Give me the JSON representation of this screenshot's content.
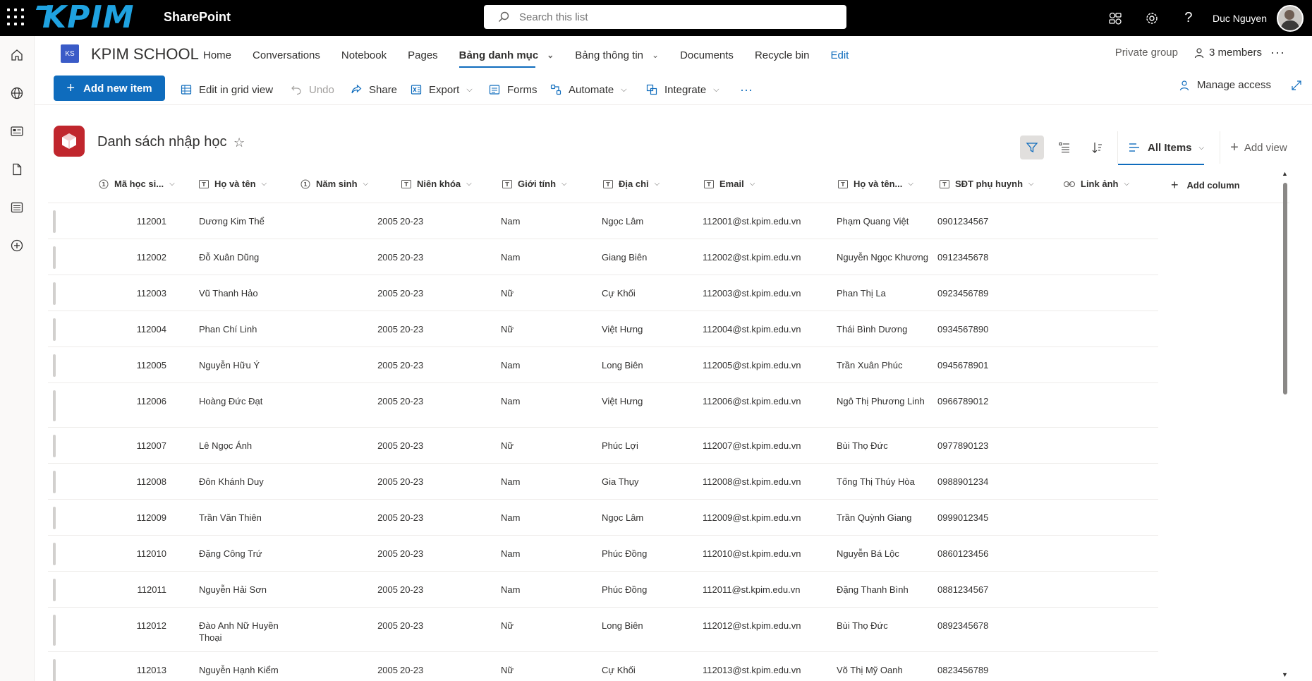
{
  "suite": {
    "logo": "KPIM",
    "app_name": "SharePoint",
    "search_placeholder": "Search this list",
    "user_name": "Duc Nguyen"
  },
  "site": {
    "icon_initials": "KS",
    "name": "KPIM SCHOOL",
    "nav": [
      {
        "label": "Home"
      },
      {
        "label": "Conversations"
      },
      {
        "label": "Notebook"
      },
      {
        "label": "Pages"
      },
      {
        "label": "Bảng danh mục"
      },
      {
        "label": "Bảng thông tin"
      },
      {
        "label": "Documents"
      },
      {
        "label": "Recycle bin"
      },
      {
        "label": "Edit"
      }
    ],
    "privacy": "Private group",
    "members": "3 members"
  },
  "commands": {
    "add_new_item": "Add new item",
    "edit_grid": "Edit in grid view",
    "undo": "Undo",
    "share": "Share",
    "export": "Export",
    "forms": "Forms",
    "automate": "Automate",
    "integrate": "Integrate",
    "manage_access": "Manage access"
  },
  "list": {
    "title": "Danh sách nhập học",
    "view_name": "All Items",
    "add_view": "Add view",
    "columns": [
      {
        "label": "Mã học si..."
      },
      {
        "label": "Họ và tên"
      },
      {
        "label": "Năm sinh"
      },
      {
        "label": "Niên khóa"
      },
      {
        "label": "Giới tính"
      },
      {
        "label": "Địa chỉ"
      },
      {
        "label": "Email"
      },
      {
        "label": "Họ và tên..."
      },
      {
        "label": "SĐT phụ huynh"
      },
      {
        "label": "Link ảnh"
      },
      {
        "label": "Add column"
      }
    ],
    "rows": [
      {
        "id": "112001",
        "name": "Dương Kim Thể",
        "year": "2005",
        "term": "20-23",
        "gender": "Nam",
        "address": "Ngọc Lâm",
        "email": "112001@st.kpim.edu.vn",
        "parent": "Phạm Quang Việt",
        "phone": "0901234567"
      },
      {
        "id": "112002",
        "name": "Đỗ Xuân Dũng",
        "year": "2005",
        "term": "20-23",
        "gender": "Nam",
        "address": "Giang Biên",
        "email": "112002@st.kpim.edu.vn",
        "parent": "Nguyễn Ngọc Khương",
        "phone": "0912345678"
      },
      {
        "id": "112003",
        "name": "Vũ Thanh Hảo",
        "year": "2005",
        "term": "20-23",
        "gender": "Nữ",
        "address": "Cự Khối",
        "email": "112003@st.kpim.edu.vn",
        "parent": "Phan Thị La",
        "phone": "0923456789"
      },
      {
        "id": "112004",
        "name": "Phan Chí Linh",
        "year": "2005",
        "term": "20-23",
        "gender": "Nữ",
        "address": "Việt Hưng",
        "email": "112004@st.kpim.edu.vn",
        "parent": "Thái Bình Dương",
        "phone": "0934567890"
      },
      {
        "id": "112005",
        "name": "Nguyễn Hữu Ý",
        "year": "2005",
        "term": "20-23",
        "gender": "Nam",
        "address": "Long Biên",
        "email": "112005@st.kpim.edu.vn",
        "parent": "Trần Xuân Phúc",
        "phone": "0945678901"
      },
      {
        "id": "112006",
        "name": "Hoàng Đức Đạt",
        "year": "2005",
        "term": "20-23",
        "gender": "Nam",
        "address": "Việt Hưng",
        "email": "112006@st.kpim.edu.vn",
        "parent": "Ngô Thị Phương Linh",
        "phone": "0966789012"
      },
      {
        "id": "112007",
        "name": "Lê Ngọc Ánh",
        "year": "2005",
        "term": "20-23",
        "gender": "Nữ",
        "address": "Phúc Lợi",
        "email": "112007@st.kpim.edu.vn",
        "parent": "Bùi Thọ Đức",
        "phone": "0977890123"
      },
      {
        "id": "112008",
        "name": "Đôn Khánh Duy",
        "year": "2005",
        "term": "20-23",
        "gender": "Nam",
        "address": "Gia Thụy",
        "email": "112008@st.kpim.edu.vn",
        "parent": "Tống Thị Thúy Hòa",
        "phone": "0988901234"
      },
      {
        "id": "112009",
        "name": "Trần Văn Thiên",
        "year": "2005",
        "term": "20-23",
        "gender": "Nam",
        "address": "Ngọc Lâm",
        "email": "112009@st.kpim.edu.vn",
        "parent": "Trần Quỳnh Giang",
        "phone": "0999012345"
      },
      {
        "id": "112010",
        "name": "Đặng Công Trứ",
        "year": "2005",
        "term": "20-23",
        "gender": "Nam",
        "address": "Phúc Đồng",
        "email": "112010@st.kpim.edu.vn",
        "parent": "Nguyễn Bá Lộc",
        "phone": "0860123456"
      },
      {
        "id": "112011",
        "name": "Nguyễn Hải Sơn",
        "year": "2005",
        "term": "20-23",
        "gender": "Nam",
        "address": "Phúc Đồng",
        "email": "112011@st.kpim.edu.vn",
        "parent": "Đặng Thanh Bình",
        "phone": "0881234567"
      },
      {
        "id": "112012",
        "name": "Đào Anh Nữ Huyền Thoại",
        "year": "2005",
        "term": "20-23",
        "gender": "Nữ",
        "address": "Long Biên",
        "email": "112012@st.kpim.edu.vn",
        "parent": "Bùi Thọ Đức",
        "phone": "0892345678"
      },
      {
        "id": "112013",
        "name": "Nguyễn Hạnh Kiểm",
        "year": "2005",
        "term": "20-23",
        "gender": "Nữ",
        "address": "Cự Khối",
        "email": "112013@st.kpim.edu.vn",
        "parent": "Võ Thị Mỹ Oanh",
        "phone": "0823456789"
      }
    ]
  },
  "colors": {
    "accent": "#0f6cbd",
    "suite_bar": "#000000",
    "logo": "#1fa2e0",
    "list_icon": "#c0262d"
  }
}
